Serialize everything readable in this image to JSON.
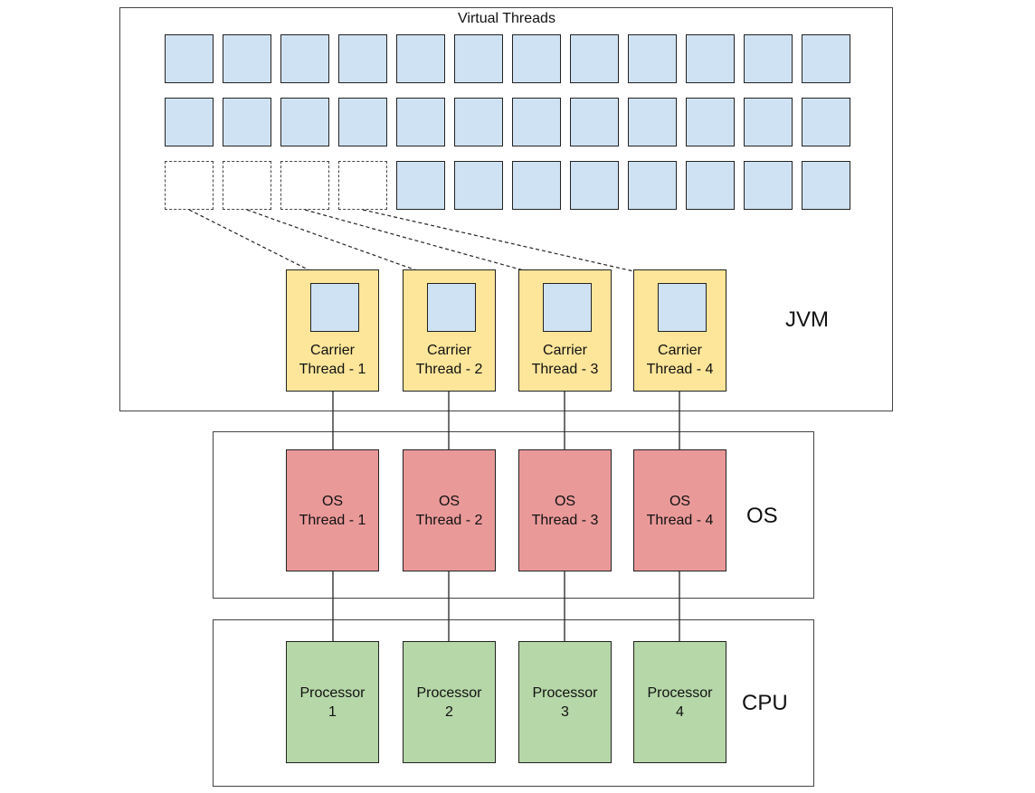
{
  "layers": {
    "jvm": {
      "label": "JVM",
      "title": "Virtual Threads"
    },
    "os": {
      "label": "OS"
    },
    "cpu": {
      "label": "CPU"
    }
  },
  "virtual_threads": {
    "rows": 3,
    "columns": 12,
    "mounted_slots_row3": 4
  },
  "carrier_threads": [
    {
      "line1": "Carrier",
      "line2": "Thread - 1"
    },
    {
      "line1": "Carrier",
      "line2": "Thread - 2"
    },
    {
      "line1": "Carrier",
      "line2": "Thread - 3"
    },
    {
      "line1": "Carrier",
      "line2": "Thread - 4"
    }
  ],
  "os_threads": [
    {
      "line1": "OS",
      "line2": "Thread - 1"
    },
    {
      "line1": "OS",
      "line2": "Thread - 2"
    },
    {
      "line1": "OS",
      "line2": "Thread - 3"
    },
    {
      "line1": "OS",
      "line2": "Thread - 4"
    }
  ],
  "processors": [
    {
      "line1": "Processor",
      "line2": "1"
    },
    {
      "line1": "Processor",
      "line2": "2"
    },
    {
      "line1": "Processor",
      "line2": "3"
    },
    {
      "line1": "Processor",
      "line2": "4"
    }
  ],
  "colors": {
    "virtual_thread": "#cfe2f3",
    "carrier_thread": "#fde59a",
    "os_thread": "#ea9999",
    "processor": "#b6d7a8"
  }
}
